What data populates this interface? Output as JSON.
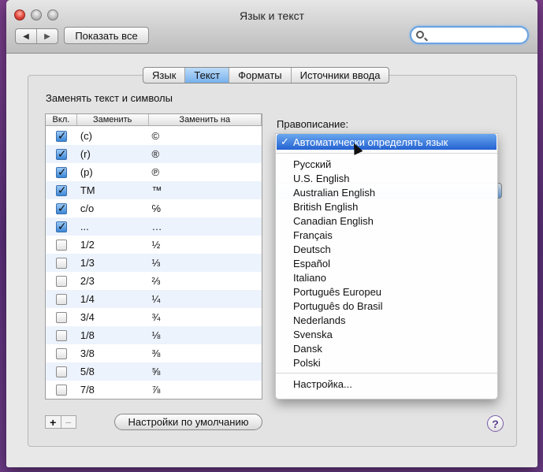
{
  "window": {
    "title": "Язык и текст"
  },
  "toolbar": {
    "back_glyph": "◀",
    "forward_glyph": "▶",
    "show_all_label": "Показать все",
    "search_value": ""
  },
  "tabs": [
    {
      "label": "Язык",
      "active": false
    },
    {
      "label": "Текст",
      "active": true
    },
    {
      "label": "Форматы",
      "active": false
    },
    {
      "label": "Источники ввода",
      "active": false
    }
  ],
  "replace_section": {
    "title": "Заменять текст и символы",
    "columns": {
      "on": "Вкл.",
      "replace": "Заменить",
      "with": "Заменить на"
    },
    "rows": [
      {
        "on": true,
        "replace": "(c)",
        "with": "©"
      },
      {
        "on": true,
        "replace": "(r)",
        "with": "®"
      },
      {
        "on": true,
        "replace": "(p)",
        "with": "℗"
      },
      {
        "on": true,
        "replace": "TM",
        "with": "™"
      },
      {
        "on": true,
        "replace": "c/o",
        "with": "℅"
      },
      {
        "on": true,
        "replace": "...",
        "with": "…"
      },
      {
        "on": false,
        "replace": "1/2",
        "with": "½"
      },
      {
        "on": false,
        "replace": "1/3",
        "with": "⅓"
      },
      {
        "on": false,
        "replace": "2/3",
        "with": "⅔"
      },
      {
        "on": false,
        "replace": "1/4",
        "with": "¼"
      },
      {
        "on": false,
        "replace": "3/4",
        "with": "¾"
      },
      {
        "on": false,
        "replace": "1/8",
        "with": "⅛"
      },
      {
        "on": false,
        "replace": "3/8",
        "with": "⅜"
      },
      {
        "on": false,
        "replace": "5/8",
        "with": "⅝"
      },
      {
        "on": false,
        "replace": "7/8",
        "with": "⅞"
      }
    ],
    "add_glyph": "+",
    "remove_glyph": "−",
    "defaults_button": "Настройки по умолчанию"
  },
  "spelling": {
    "label": "Правописание:",
    "selected_check": "✓",
    "selected": "Автоматически определять язык",
    "options": [
      "Русский",
      "U.S. English",
      "Australian English",
      "British English",
      "Canadian English",
      "Français",
      "Deutsch",
      "Español",
      "Italiano",
      "Português Europeu",
      "Português do Brasil",
      "Nederlands",
      "Svenska",
      "Dansk",
      "Polski"
    ],
    "setup_item": "Настройка..."
  },
  "help_glyph": "?"
}
